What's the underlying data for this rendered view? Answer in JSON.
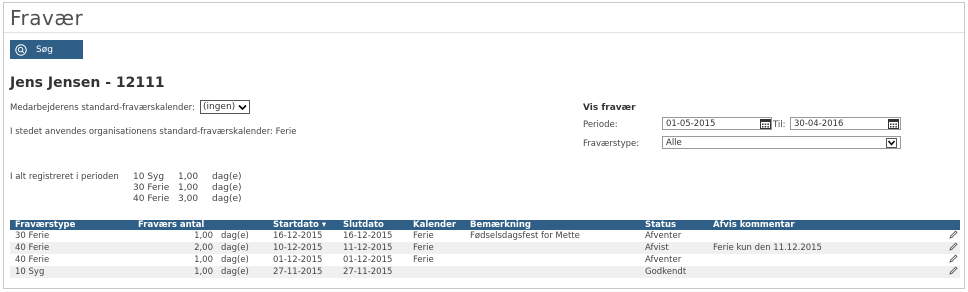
{
  "page": {
    "title": "Fravær"
  },
  "search_button": {
    "label": "Søg",
    "icon": "search-icon"
  },
  "employee": {
    "name": "Jens Jensen - 12111",
    "standard_calendar_label": "Medarbejderens standard-fraværskalender:",
    "standard_calendar_value": "(ingen)",
    "org_calendar_text": "I stedet anvendes organisationens standard-fraværskalender: Ferie"
  },
  "vis_fravaer": {
    "title": "Vis fravær",
    "periode_label": "Periode:",
    "from_date": "01-05-2015",
    "til_label": "Til:",
    "to_date": "30-04-2016",
    "type_label": "Fraværstype:",
    "type_value": "Alle"
  },
  "summary": {
    "label": "I alt registreret i perioden",
    "rows": [
      {
        "type": "10 Syg",
        "amount": "1,00",
        "unit": "dag(e)"
      },
      {
        "type": "30 Ferie",
        "amount": "1,00",
        "unit": "dag(e)"
      },
      {
        "type": "40 Ferie",
        "amount": "3,00",
        "unit": "dag(e)"
      }
    ]
  },
  "table": {
    "headers": [
      "Fraværstype",
      "Fraværs antal",
      "Startdato ▾",
      "Slutdato",
      "Kalender",
      "Bemærkning",
      "Status",
      "Afvis kommentar"
    ],
    "rows": [
      {
        "type": "30 Ferie",
        "amount": "1,00",
        "unit": "dag(e)",
        "start": "16-12-2015",
        "end": "16-12-2015",
        "calendar": "Ferie",
        "note": "Fødselsdagsfest for Mette",
        "status": "Afventer",
        "reject_comment": ""
      },
      {
        "type": "40 Ferie",
        "amount": "2,00",
        "unit": "dag(e)",
        "start": "10-12-2015",
        "end": "11-12-2015",
        "calendar": "Ferie",
        "note": "",
        "status": "Afvist",
        "reject_comment": "Ferie kun den 11.12.2015"
      },
      {
        "type": "40 Ferie",
        "amount": "1,00",
        "unit": "dag(e)",
        "start": "01-12-2015",
        "end": "01-12-2015",
        "calendar": "Ferie",
        "note": "",
        "status": "Afventer",
        "reject_comment": ""
      },
      {
        "type": "10 Syg",
        "amount": "1,00",
        "unit": "dag(e)",
        "start": "27-11-2015",
        "end": "27-11-2015",
        "calendar": "",
        "note": "",
        "status": "Godkendt",
        "reject_comment": ""
      }
    ]
  },
  "colors": {
    "accent": "#2f5f86",
    "row_alt": "#f0f0f0"
  }
}
